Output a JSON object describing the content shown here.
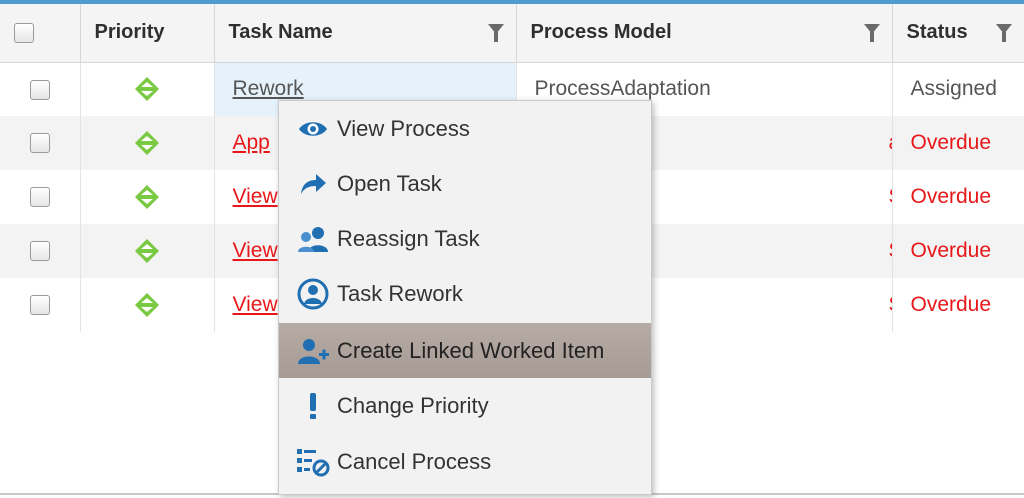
{
  "columns": {
    "priority": "Priority",
    "task_name": "Task Name",
    "process_model": "Process Model",
    "status": "Status"
  },
  "rows": [
    {
      "task": "Rework",
      "process": "ProcessAdaptation",
      "status": "Assigned"
    },
    {
      "task": "App",
      "process": "aracters",
      "status": "Overdue"
    },
    {
      "task": "View",
      "process": "S",
      "status": "Overdue"
    },
    {
      "task": "View",
      "process": "S",
      "status": "Overdue"
    },
    {
      "task": "View",
      "process": "S",
      "status": "Overdue"
    }
  ],
  "context_menu": {
    "items": [
      {
        "label": "View Process",
        "icon": "eye-icon"
      },
      {
        "label": "Open Task",
        "icon": "share-arrow-icon"
      },
      {
        "label": "Reassign Task",
        "icon": "users-icon"
      },
      {
        "label": "Task Rework",
        "icon": "user-circle-icon"
      },
      {
        "label": "Create Linked Worked Item",
        "icon": "add-user-icon",
        "highlighted": true
      },
      {
        "label": "Change Priority",
        "icon": "exclamation-icon"
      },
      {
        "label": "Cancel Process",
        "icon": "cancel-process-icon"
      }
    ]
  },
  "colors": {
    "accent": "#4f9bd0",
    "overdue": "#e8171a",
    "priority": "#7ac943",
    "menu_highlight": "#aea39c",
    "icon_blue": "#1f6fb2"
  }
}
